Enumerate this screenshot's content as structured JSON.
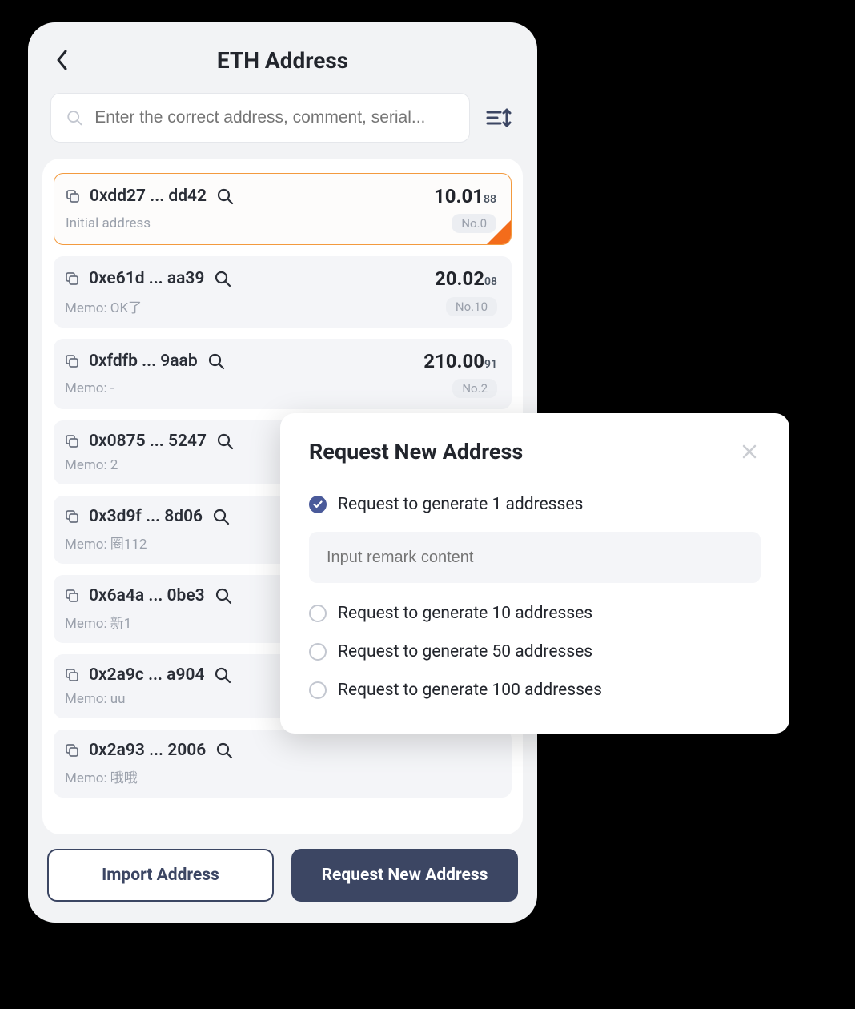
{
  "header": {
    "title": "ETH Address"
  },
  "search": {
    "placeholder": "Enter the correct address, comment, serial..."
  },
  "addresses": [
    {
      "addr": "0xdd27 ... dd42",
      "amount": "10.01",
      "amount_sub": "88",
      "memo": "Initial address",
      "no": "No.0",
      "selected": true
    },
    {
      "addr": "0xe61d ... aa39",
      "amount": "20.02",
      "amount_sub": "08",
      "memo": "Memo: OK了",
      "no": "No.10",
      "selected": false
    },
    {
      "addr": "0xfdfb ... 9aab",
      "amount": "210.00",
      "amount_sub": "91",
      "memo": "Memo: -",
      "no": "No.2",
      "selected": false
    },
    {
      "addr": "0x0875 ... 5247",
      "amount": "",
      "amount_sub": "",
      "memo": "Memo: 2",
      "no": "",
      "selected": false
    },
    {
      "addr": "0x3d9f ... 8d06",
      "amount": "",
      "amount_sub": "",
      "memo": "Memo: 圈112",
      "no": "",
      "selected": false
    },
    {
      "addr": "0x6a4a ... 0be3",
      "amount": "",
      "amount_sub": "",
      "memo": "Memo: 新1",
      "no": "",
      "selected": false
    },
    {
      "addr": "0x2a9c ... a904",
      "amount": "",
      "amount_sub": "",
      "memo": "Memo: uu",
      "no": "",
      "selected": false
    },
    {
      "addr": "0x2a93 ... 2006",
      "amount": "",
      "amount_sub": "",
      "memo": "Memo: 哦哦",
      "no": "",
      "selected": false
    }
  ],
  "footer": {
    "import_label": "Import Address",
    "request_label": "Request New Address"
  },
  "modal": {
    "title": "Request New Address",
    "remark_placeholder": "Input remark content",
    "options": [
      {
        "label": "Request to generate 1 addresses",
        "checked": true,
        "has_remark": true
      },
      {
        "label": "Request to generate 10 addresses",
        "checked": false,
        "has_remark": false
      },
      {
        "label": "Request to generate 50 addresses",
        "checked": false,
        "has_remark": false
      },
      {
        "label": "Request to generate 100 addresses",
        "checked": false,
        "has_remark": false
      }
    ]
  }
}
